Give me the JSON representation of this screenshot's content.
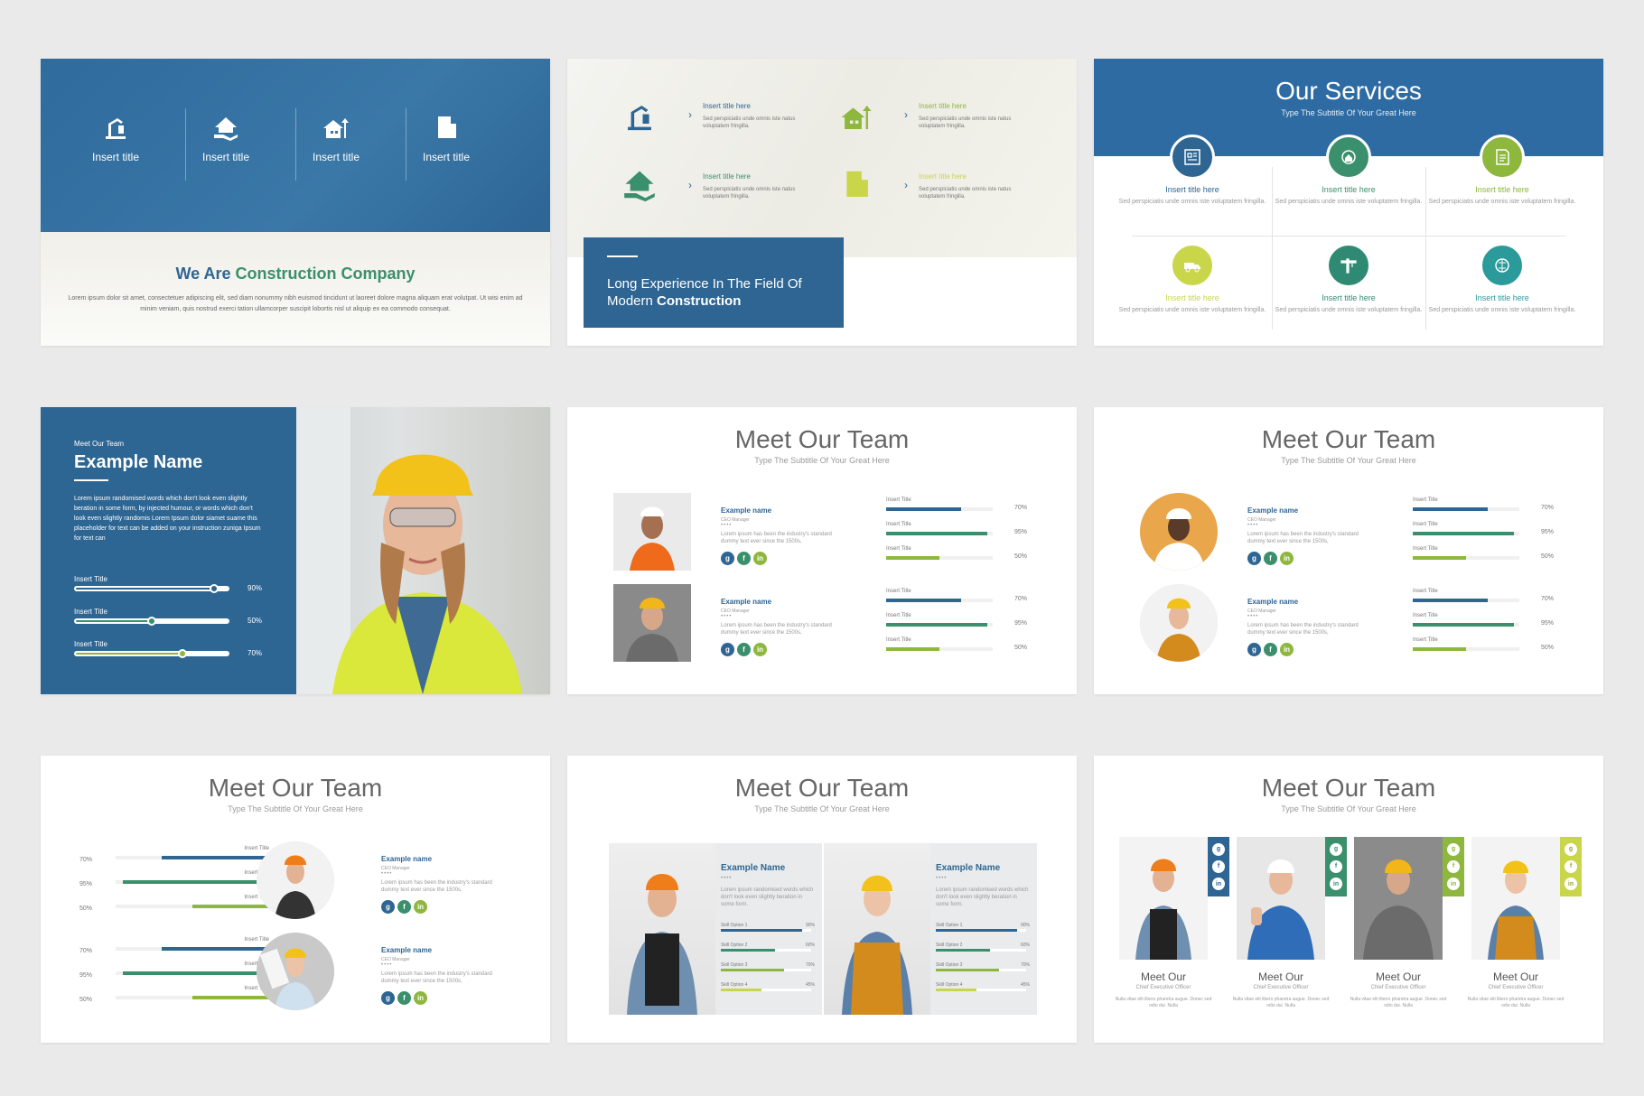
{
  "colors": {
    "blue": "#2e6593",
    "green": "#3a8f6c",
    "lime": "#8db73d",
    "teal": "#2a9a9a",
    "gray_bg": "#ebeaeb"
  },
  "slide1": {
    "items": [
      {
        "icon": "crane-icon",
        "label": "Insert title"
      },
      {
        "icon": "house-hand-icon",
        "label": "Insert title"
      },
      {
        "icon": "house-arrow-icon",
        "label": "Insert title"
      },
      {
        "icon": "building-icon",
        "label": "Insert title"
      }
    ],
    "title_a": "We Are",
    "title_b": "Construction Company",
    "text": "Lorem ipsum dolor sit amet, consectetuer adipiscing elit, sed diam nonummy nibh euismod tincidunt ut laoreet dolore magna aliquam erat volutpat. Ut wisi enim ad minim veniam, quis nostrud exerci tation ullamcorper suscipit lobortis nisl ut aliquip ex ea commodo consequat."
  },
  "slide2": {
    "items": [
      {
        "title": "Insert title here",
        "text": "Sed perspiciatis unde omnis iste natus voluptatem fringilla."
      },
      {
        "title": "Insert title here",
        "text": "Sed perspiciatis unde omnis iste natus voluptatem fringilla."
      },
      {
        "title": "Insert title here",
        "text": "Sed perspiciatis unde omnis iste natus voluptatem fringilla."
      },
      {
        "title": "Insert title here",
        "text": "Sed perspiciatis unde omnis iste natus voluptatem fringilla."
      }
    ],
    "box_line1": "Long Experience In The Field Of",
    "box_line2a": "Modern",
    "box_line2b": "Construction"
  },
  "slide3": {
    "title": "Our Services",
    "subtitle": "Type The Subtitle Of Your Great Here",
    "cells": [
      {
        "title": "Insert title here",
        "text": "Sed perspiciatis unde omnis iste voluptatem fringilla."
      },
      {
        "title": "Insert title here",
        "text": "Sed perspiciatis unde omnis iste voluptatem fringilla."
      },
      {
        "title": "Insert title here",
        "text": "Sed perspiciatis unde omnis iste voluptatem fringilla."
      },
      {
        "title": "Insert title here",
        "text": "Sed perspiciatis unde omnis iste voluptatem fringilla."
      },
      {
        "title": "Insert title here",
        "text": "Sed perspiciatis unde omnis iste voluptatem fringilla."
      },
      {
        "title": "Insert title here",
        "text": "Sed perspiciatis unde omnis iste voluptatem fringilla."
      }
    ]
  },
  "slide4": {
    "kicker": "Meet Our Team",
    "name": "Example Name",
    "text": "Lorem ipsum randomised words which don't look even slightly beration in some form, by injected humour, or words which don't look even slightly randomis Lorem Ipsum dolor siamet suame this placeholder for text can be added on your instruction zuniga Ipsum for text can",
    "skills": [
      {
        "label": "Insert Title",
        "pct": "90%",
        "value": 90
      },
      {
        "label": "Insert Title",
        "pct": "50%",
        "value": 50
      },
      {
        "label": "Insert Title",
        "pct": "70%",
        "value": 70
      }
    ]
  },
  "team": {
    "title": "Meet Our Team",
    "subtitle": "Type The Subtitle Of Your Great Here",
    "member_name": "Example name",
    "member_role": "CEO Manager",
    "member_desc": "Lorem ipsum has been the industry's standard dummy text ever since the 1500s,",
    "bar_label": "Insert Title",
    "bars": [
      {
        "pct": "70%",
        "value": 70
      },
      {
        "pct": "95%",
        "value": 95
      },
      {
        "pct": "50%",
        "value": 50
      }
    ]
  },
  "slide8": {
    "title": "Meet Our Team",
    "subtitle": "Type The Subtitle Of Your Great Here",
    "members": [
      {
        "name": "Example Name",
        "desc": "Lorem ipsum randomised words which don't look even slightly beration in some form."
      },
      {
        "name": "Example Name",
        "desc": "Lorem ipsum randomised words which don't look even slightly beration in some form."
      }
    ],
    "skills": [
      {
        "label": "Skill Option 1",
        "pct": "90%",
        "value": 90
      },
      {
        "label": "Skill Option 2",
        "pct": "60%",
        "value": 60
      },
      {
        "label": "Skill Option 3",
        "pct": "70%",
        "value": 70
      },
      {
        "label": "Skill Option 4",
        "pct": "45%",
        "value": 45
      }
    ]
  },
  "slide9": {
    "title": "Meet Our Team",
    "subtitle": "Type The Subtitle Of Your Great Here",
    "members": [
      {
        "name": "Meet Our",
        "role": "Chief Executive Officer",
        "desc": "Nulla vitae elit libero pharetra augue. Donec sed odio dui. Nulla"
      },
      {
        "name": "Meet Our",
        "role": "Chief Executive Officer",
        "desc": "Nulla vitae elit libero pharetra augue. Donec sed odio dui. Nulla"
      },
      {
        "name": "Meet Our",
        "role": "Chief Executive Officer",
        "desc": "Nulla vitae elit libero pharetra augue. Donec sed odio dui. Nulla"
      },
      {
        "name": "Meet Our",
        "role": "Chief Executive Officer",
        "desc": "Nulla vitae elit libero pharetra augue. Donec sed odio dui. Nulla"
      }
    ],
    "social": [
      "google-plus-icon",
      "facebook-icon",
      "linkedin-icon"
    ]
  }
}
